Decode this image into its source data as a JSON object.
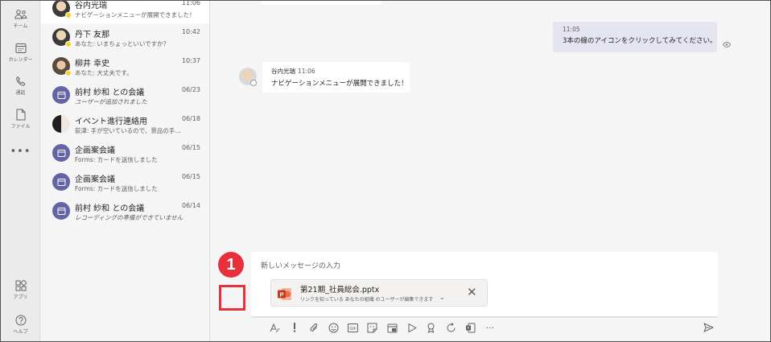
{
  "rail": {
    "items": [
      {
        "label": "チーム",
        "icon": "teams-icon"
      },
      {
        "label": "カレンダー",
        "icon": "calendar-icon"
      },
      {
        "label": "通話",
        "icon": "phone-icon"
      },
      {
        "label": "ファイル",
        "icon": "file-icon"
      },
      {
        "label": "•••",
        "icon": "more-icon"
      },
      {
        "label": "アプリ",
        "icon": "apps-icon"
      },
      {
        "label": "ヘルプ",
        "icon": "help-icon"
      }
    ]
  },
  "chats": [
    {
      "name": "谷内光瑞",
      "time": "11:06",
      "preview": "ナビゲーションメニューが展開できました！",
      "avatar": "photo",
      "selected": true,
      "italic": false
    },
    {
      "name": "丹下 友那",
      "time": "10:42",
      "preview": "あなた: いまちょっといいですか？",
      "avatar": "photo",
      "selected": false,
      "italic": false
    },
    {
      "name": "柳井 幸史",
      "time": "10:37",
      "preview": "あなた: 大丈夫です。",
      "avatar": "photo2",
      "selected": false,
      "italic": false
    },
    {
      "name": "前村 紗和 との会議",
      "time": "06/23",
      "preview": "ユーザーが追加されました",
      "avatar": "meeting",
      "selected": false,
      "italic": true
    },
    {
      "name": "イベント進行連絡用",
      "time": "06/18",
      "preview": "荻津: 手が空いているので、景品の手…",
      "avatar": "group",
      "selected": false,
      "italic": false
    },
    {
      "name": "企画案会議",
      "time": "06/15",
      "preview": "Forms: カードを送信しました",
      "avatar": "meeting",
      "selected": false,
      "italic": false
    },
    {
      "name": "企画案会議",
      "time": "06/15",
      "preview": "Forms: カードを送信しました",
      "avatar": "meeting",
      "selected": false,
      "italic": false
    },
    {
      "name": "前村 紗和 との会議",
      "time": "06/14",
      "preview": "レコーディングの準備ができていません",
      "avatar": "meeting",
      "selected": false,
      "italic": true
    }
  ],
  "conversation": {
    "my_message": {
      "time": "11:05",
      "text": "3本の線のアイコンをクリックしてみてください。"
    },
    "reply": {
      "sender": "谷内光瑞",
      "time": "11:06",
      "text": "ナビゲーションメニューが展開できました！"
    }
  },
  "compose": {
    "placeholder": "新しいメッセージの入力",
    "attachment": {
      "file_name": "第21期_社員総会.pptx",
      "sharing_text": "リンクを知っている あなたの組織 のユーザーが編集できます"
    },
    "callout_number": "1"
  },
  "toolbar": {
    "icons": [
      "format-icon",
      "important-icon",
      "attach-icon",
      "emoji-icon",
      "gif-icon",
      "sticker-icon",
      "meet-icon",
      "stream-icon",
      "praise-icon",
      "loop-icon",
      "forms-icon",
      "more-icon"
    ],
    "more_label": "···"
  },
  "colors": {
    "accent": "#6264a7",
    "highlight": "#e8303a",
    "my_bubble": "#e5e5f1"
  }
}
